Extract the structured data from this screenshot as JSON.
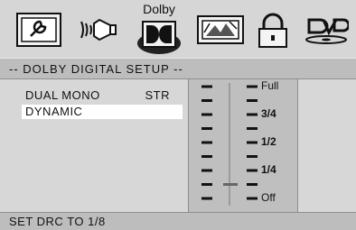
{
  "toolbar": {
    "items": [
      {
        "name": "setup-icon"
      },
      {
        "name": "audio-speaker-icon"
      },
      {
        "name": "dolby-icon",
        "label": "Dolby"
      },
      {
        "name": "video-icon"
      },
      {
        "name": "lock-icon"
      },
      {
        "name": "dvd-logo-icon"
      }
    ]
  },
  "header": {
    "title": "-- DOLBY DIGITAL SETUP --"
  },
  "menu": {
    "items": [
      {
        "label": "DUAL MONO",
        "value": "STR"
      },
      {
        "label": "DYNAMIC",
        "value": ""
      }
    ],
    "selected_index": 1
  },
  "drc_slider": {
    "labels": [
      "Full",
      "3/4",
      "1/2",
      "1/4",
      "Off"
    ],
    "current_level": 0.125
  },
  "status": {
    "message": "SET DRC TO 1/8"
  },
  "colors": {
    "background": "#d7d7d7",
    "header": "#bdbdbd",
    "highlight": "#ffffff"
  }
}
